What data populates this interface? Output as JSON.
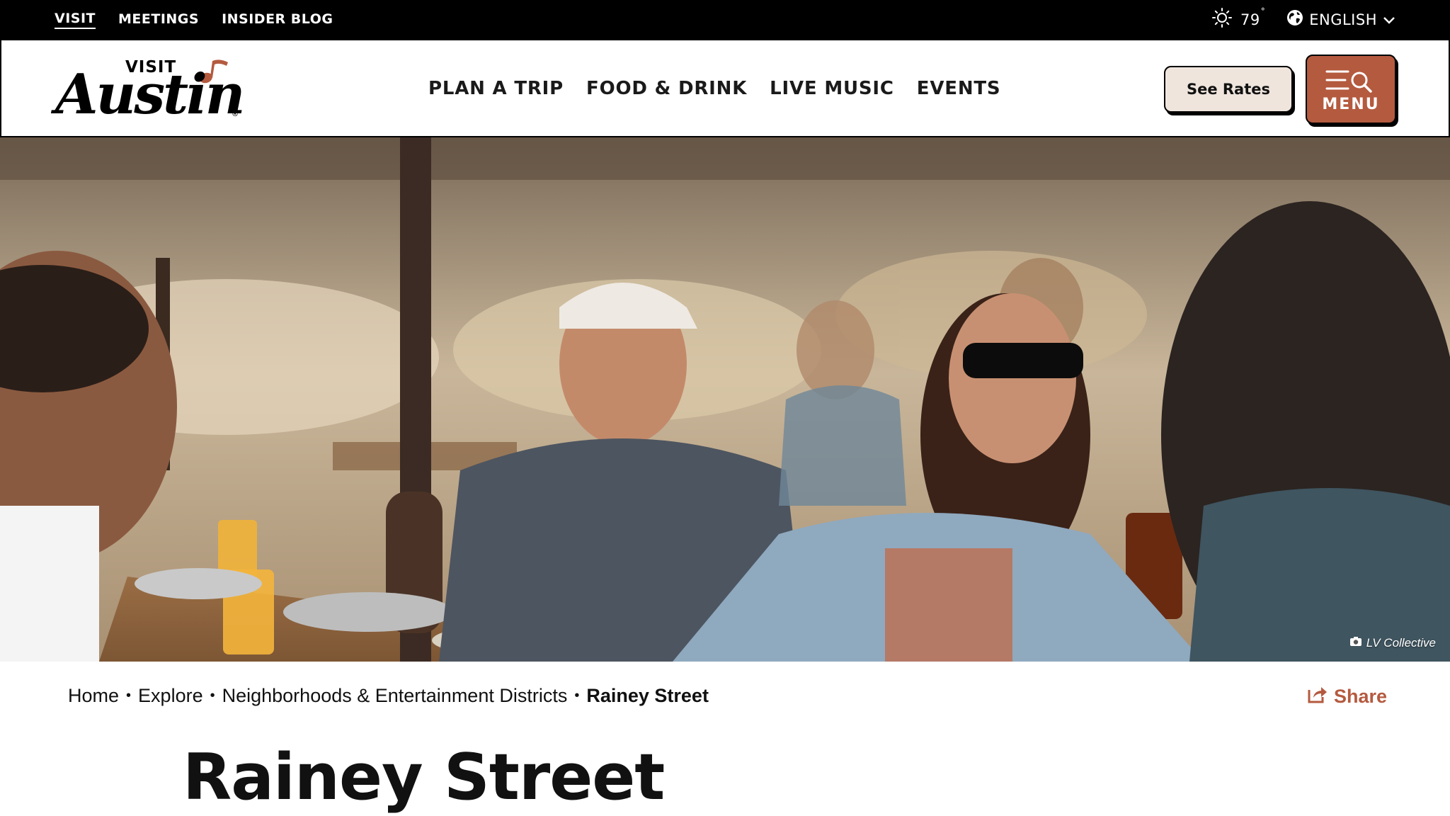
{
  "utility_bar": {
    "links": [
      {
        "label": "VISIT",
        "active": true
      },
      {
        "label": "MEETINGS",
        "active": false
      },
      {
        "label": "INSIDER BLOG",
        "active": false
      }
    ],
    "weather": {
      "temperature": "79",
      "degree_symbol": "°",
      "icon": "sun-icon"
    },
    "language": {
      "label": "ENGLISH",
      "icon": "globe-icon"
    }
  },
  "header": {
    "logo": {
      "visit": "VISIT",
      "austin": "Austin",
      "registered": "®"
    },
    "nav": [
      "PLAN A TRIP",
      "FOOD & DRINK",
      "LIVE MUSIC",
      "EVENTS"
    ],
    "see_rates_label": "See Rates",
    "menu_label": "MENU"
  },
  "hero": {
    "photo_credit": "LV Collective"
  },
  "breadcrumb": {
    "items": [
      "Home",
      "Explore",
      "Neighborhoods & Entertainment Districts"
    ],
    "current": "Rainey Street",
    "separator": "•"
  },
  "share_label": "Share",
  "page_title": "Rainey Street",
  "colors": {
    "accent": "#b45a3f",
    "see_rates_bg": "#efe5dd",
    "bar_bg": "#000000"
  }
}
